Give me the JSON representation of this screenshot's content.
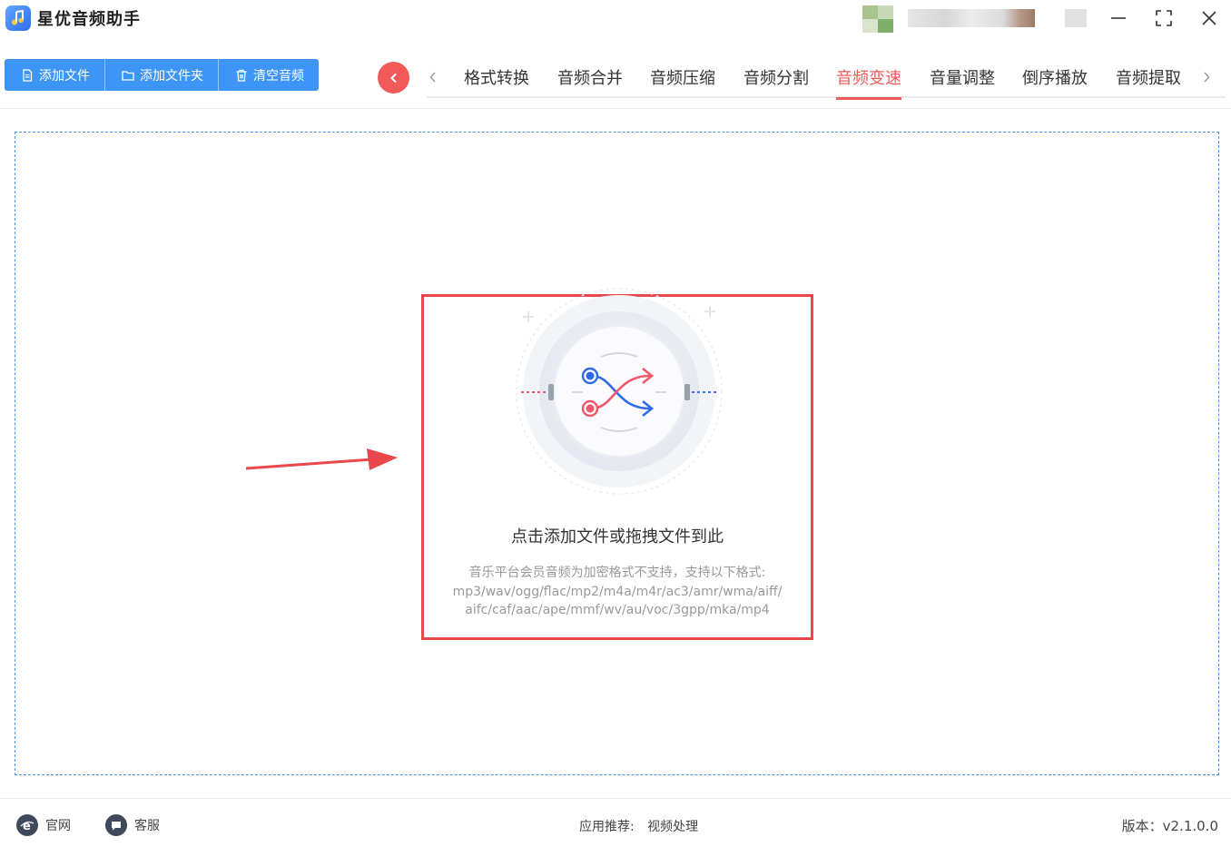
{
  "app": {
    "title": "星优音频助手"
  },
  "toolbar": {
    "add_file": "添加文件",
    "add_folder": "添加文件夹",
    "clear_audio": "清空音频"
  },
  "tabs": [
    {
      "label": "格式转换"
    },
    {
      "label": "音频合并"
    },
    {
      "label": "音频压缩"
    },
    {
      "label": "音频分割"
    },
    {
      "label": "音频变速",
      "active": true
    },
    {
      "label": "音量调整"
    },
    {
      "label": "倒序播放"
    },
    {
      "label": "音频提取"
    }
  ],
  "drop": {
    "title": "点击添加文件或拖拽文件到此",
    "desc_line1": "音乐平台会员音频为加密格式不支持，支持以下格式:",
    "desc_line2": "mp3/wav/ogg/flac/mp2/m4a/m4r/ac3/amr/wma/aiff/",
    "desc_line3": "aifc/caf/aac/ape/mmf/wv/au/voc/3gpp/mka/mp4"
  },
  "footer": {
    "website": "官网",
    "service": "客服",
    "recommend_label": "应用推荐:",
    "recommend_link": "视频处理",
    "version": "版本：v2.1.0.0"
  },
  "colors": {
    "primary_blue": "#3d95f5",
    "accent_red": "#f25a5a",
    "highlight_border": "#e8474c",
    "dashed_border": "#4a90e2"
  },
  "icons": {
    "logo": "music-note-icon",
    "add_file": "file-icon",
    "add_folder": "folder-icon",
    "clear": "trash-icon",
    "back": "chevron-left-icon",
    "website": "ie-browser-icon",
    "service": "chat-bubble-icon"
  }
}
